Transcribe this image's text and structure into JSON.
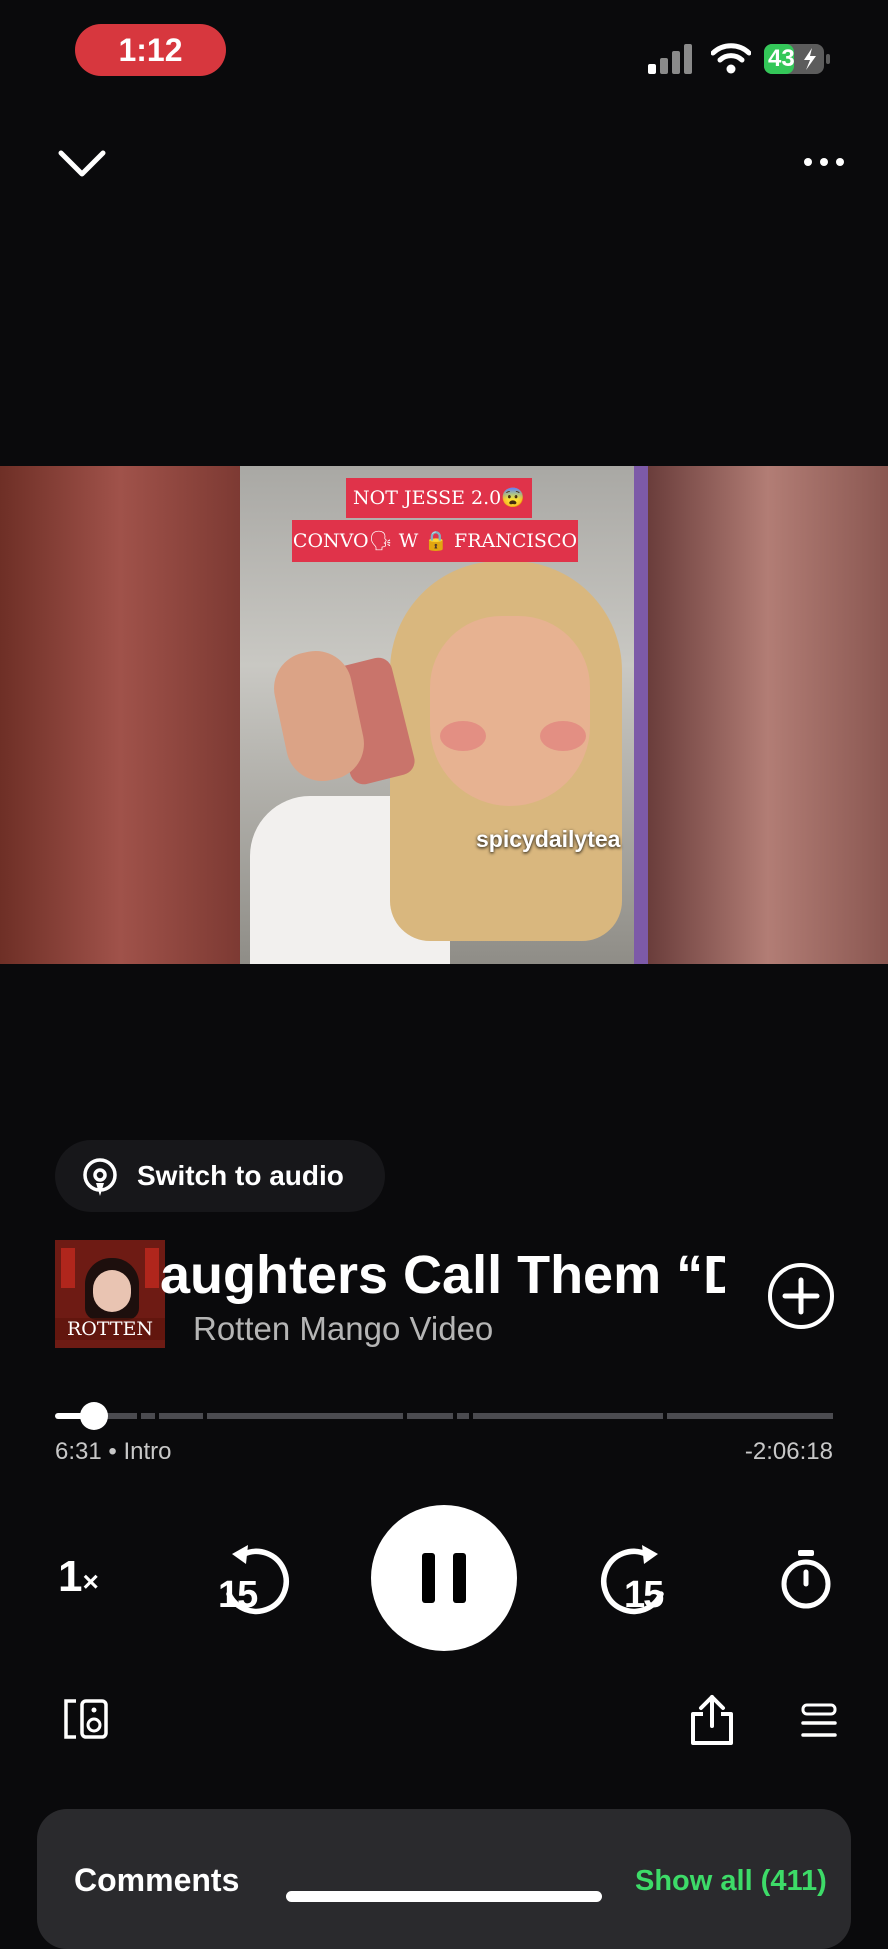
{
  "status_bar": {
    "time": "1:12",
    "battery": "43",
    "time_pill_color": "#d7373e",
    "battery_color": "#34c759"
  },
  "header": {
    "collapse_icon": "chevron-down-icon",
    "more_icon": "more-horizontal-icon"
  },
  "video": {
    "banner_line_1": "NOT JESSE 2.0😨",
    "banner_line_2": "CONVO🗣 W 🔒 FRANCISCO",
    "watermark": "spicydailytea"
  },
  "switch_audio": {
    "label": "Switch to audio",
    "icon": "podcast-audio-icon"
  },
  "track": {
    "art_label": "ROTTEN",
    "title": "aughters Call Them “Da",
    "subtitle": "Rotten Mango Video",
    "add_icon": "add-circle-icon"
  },
  "progress": {
    "elapsed": "6:31",
    "chapter": "Intro",
    "remaining": "-2:06:18",
    "fraction": 0.05
  },
  "controls": {
    "speed": "1",
    "speed_suffix": "×",
    "rewind_seconds": "15",
    "forward_seconds": "15",
    "play_state": "pause-icon",
    "timer_icon": "sleep-timer-icon",
    "devices_icon": "connect-devices-icon",
    "share_icon": "share-icon",
    "queue_icon": "queue-icon"
  },
  "comments": {
    "title": "Comments",
    "show_all": "Show all (411)",
    "accent": "#3ddb68"
  }
}
